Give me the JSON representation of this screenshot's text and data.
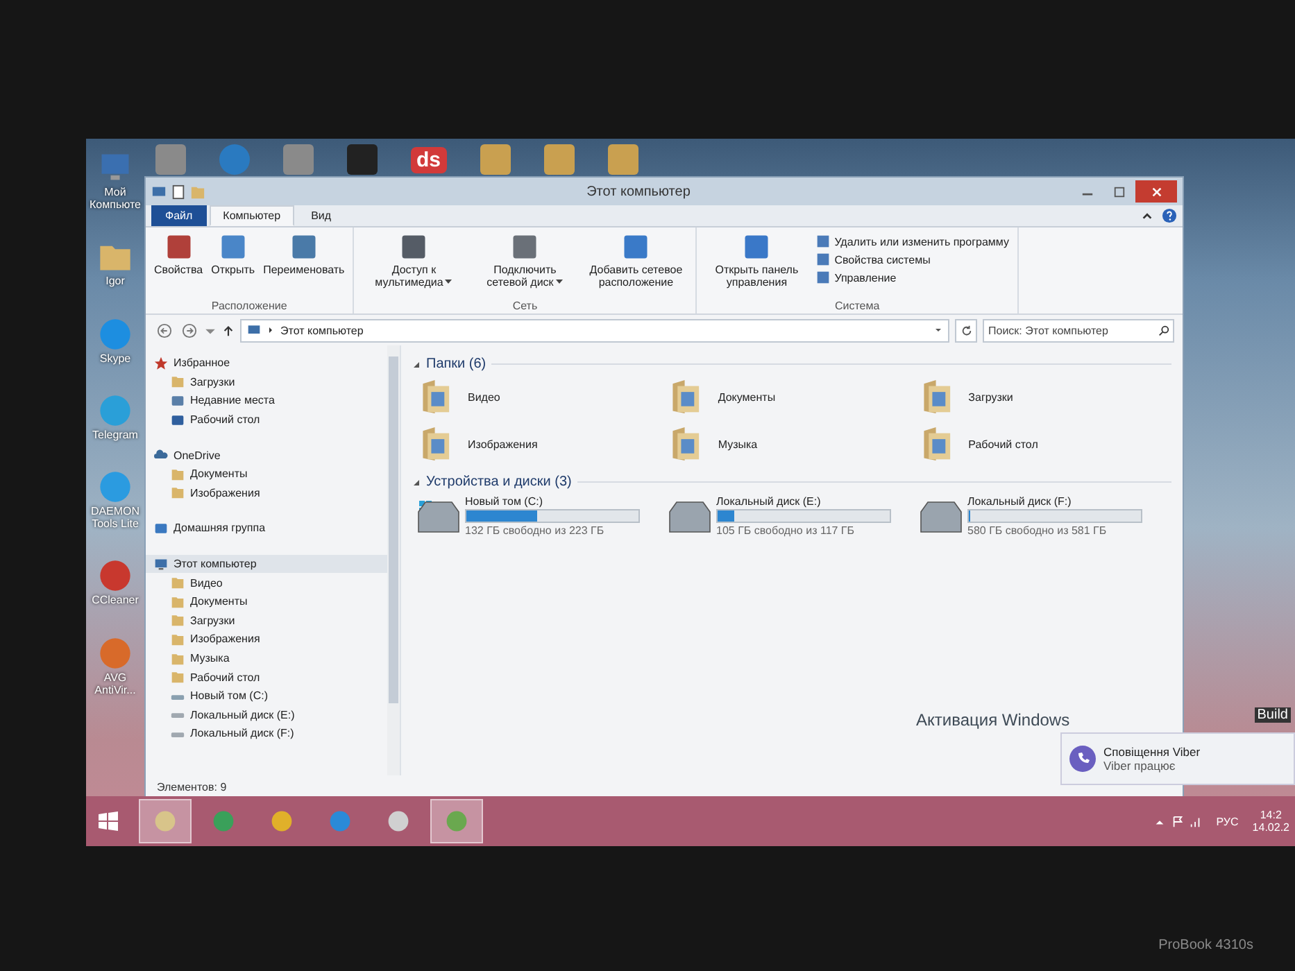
{
  "desktop_icons": [
    {
      "label": "Мой Компьюте",
      "kind": "computer"
    },
    {
      "label": "Igor",
      "kind": "folder"
    },
    {
      "label": "Skype",
      "kind": "skype"
    },
    {
      "label": "Telegram",
      "kind": "telegram"
    },
    {
      "label": "DAEMON Tools Lite",
      "kind": "daemon"
    },
    {
      "label": "CCleaner",
      "kind": "ccleaner"
    },
    {
      "label": "AVG AntiVir...",
      "kind": "avg"
    }
  ],
  "top_logo": "ds",
  "window": {
    "title": "Этот компьютер"
  },
  "tabs": [
    {
      "label": "Файл",
      "kind": "file",
      "selected": false
    },
    {
      "label": "Компьютер",
      "kind": "tab",
      "selected": true
    },
    {
      "label": "Вид",
      "kind": "tab",
      "selected": false
    }
  ],
  "ribbon": [
    {
      "label": "Расположение",
      "buttons": [
        {
          "label": "Свойства",
          "kind": "properties",
          "dropdown": false
        },
        {
          "label": "Открыть",
          "kind": "open",
          "dropdown": false
        },
        {
          "label": "Переименовать",
          "kind": "rename",
          "dropdown": false
        }
      ]
    },
    {
      "label": "Сеть",
      "buttons": [
        {
          "label": "Доступ к мультимедиа",
          "kind": "media",
          "dropdown": true
        },
        {
          "label": "Подключить сетевой диск",
          "kind": "netdrive",
          "dropdown": true
        },
        {
          "label": "Добавить сетевое расположение",
          "kind": "netplace",
          "dropdown": false
        }
      ]
    },
    {
      "label": "Система",
      "buttons": [
        {
          "label": "Открыть панель управления",
          "kind": "control",
          "dropdown": false
        }
      ],
      "small": [
        "Удалить или изменить программу",
        "Свойства системы",
        "Управление"
      ]
    }
  ],
  "address": {
    "path": "Этот компьютер",
    "search_placeholder": "Поиск: Этот компьютер"
  },
  "nav": [
    {
      "label": "Избранное",
      "kind": "star",
      "selected": false,
      "children": [
        {
          "label": "Загрузки",
          "kind": "folder",
          "selected": false
        },
        {
          "label": "Недавние места",
          "kind": "recent",
          "selected": false
        },
        {
          "label": "Рабочий стол",
          "kind": "desktop",
          "selected": false
        }
      ]
    },
    {
      "label": "OneDrive",
      "kind": "cloud",
      "selected": false,
      "children": [
        {
          "label": "Документы",
          "kind": "folder",
          "selected": false
        },
        {
          "label": "Изображения",
          "kind": "folder",
          "selected": false
        }
      ]
    },
    {
      "label": "Домашняя группа",
      "kind": "homegroup",
      "selected": false
    },
    {
      "label": "Этот компьютер",
      "kind": "computer",
      "selected": true,
      "children": [
        {
          "label": "Видео",
          "kind": "folder",
          "selected": false
        },
        {
          "label": "Документы",
          "kind": "folder",
          "selected": false
        },
        {
          "label": "Загрузки",
          "kind": "folder",
          "selected": false
        },
        {
          "label": "Изображения",
          "kind": "folder",
          "selected": false
        },
        {
          "label": "Музыка",
          "kind": "folder",
          "selected": false
        },
        {
          "label": "Рабочий стол",
          "kind": "folder",
          "selected": false
        },
        {
          "label": "Новый том (C:)",
          "kind": "sysdrive",
          "selected": false
        },
        {
          "label": "Локальный диск (E:)",
          "kind": "drive",
          "selected": false
        },
        {
          "label": "Локальный диск (F:)",
          "kind": "drive",
          "selected": false
        }
      ]
    }
  ],
  "folders": {
    "header": "Папки (6)",
    "items": [
      {
        "label": "Видео"
      },
      {
        "label": "Документы"
      },
      {
        "label": "Загрузки"
      },
      {
        "label": "Изображения"
      },
      {
        "label": "Музыка"
      },
      {
        "label": "Рабочий стол"
      }
    ]
  },
  "drives": {
    "header": "Устройства и диски (3)",
    "items": [
      {
        "label": "Новый том (C:)",
        "kind": "sysdrive",
        "level": 0.41,
        "free": "132 ГБ свободно из 223 ГБ"
      },
      {
        "label": "Локальный диск (E:)",
        "kind": "drive",
        "level": 0.1,
        "free": "105 ГБ свободно из 117 ГБ"
      },
      {
        "label": "Локальный диск (F:)",
        "kind": "drive",
        "level": 0.002,
        "free": "580 ГБ свободно из 581 ГБ"
      }
    ]
  },
  "status_bar": "Элементов: 9",
  "activation": "Активация Windows",
  "notification": {
    "title": "Сповіщення Viber",
    "text": "Viber працює"
  },
  "build": "Build",
  "taskbar": [
    {
      "kind": "explorer",
      "open": true
    },
    {
      "kind": "store",
      "open": false
    },
    {
      "kind": "chrome",
      "open": false
    },
    {
      "kind": "edge",
      "open": false
    },
    {
      "kind": "app",
      "open": false
    },
    {
      "kind": "torrent",
      "open": true
    }
  ],
  "tray": {
    "language": "РУС",
    "time": "14:2",
    "date": "14.02.2"
  },
  "bezel_label": "ProBook 4310s"
}
